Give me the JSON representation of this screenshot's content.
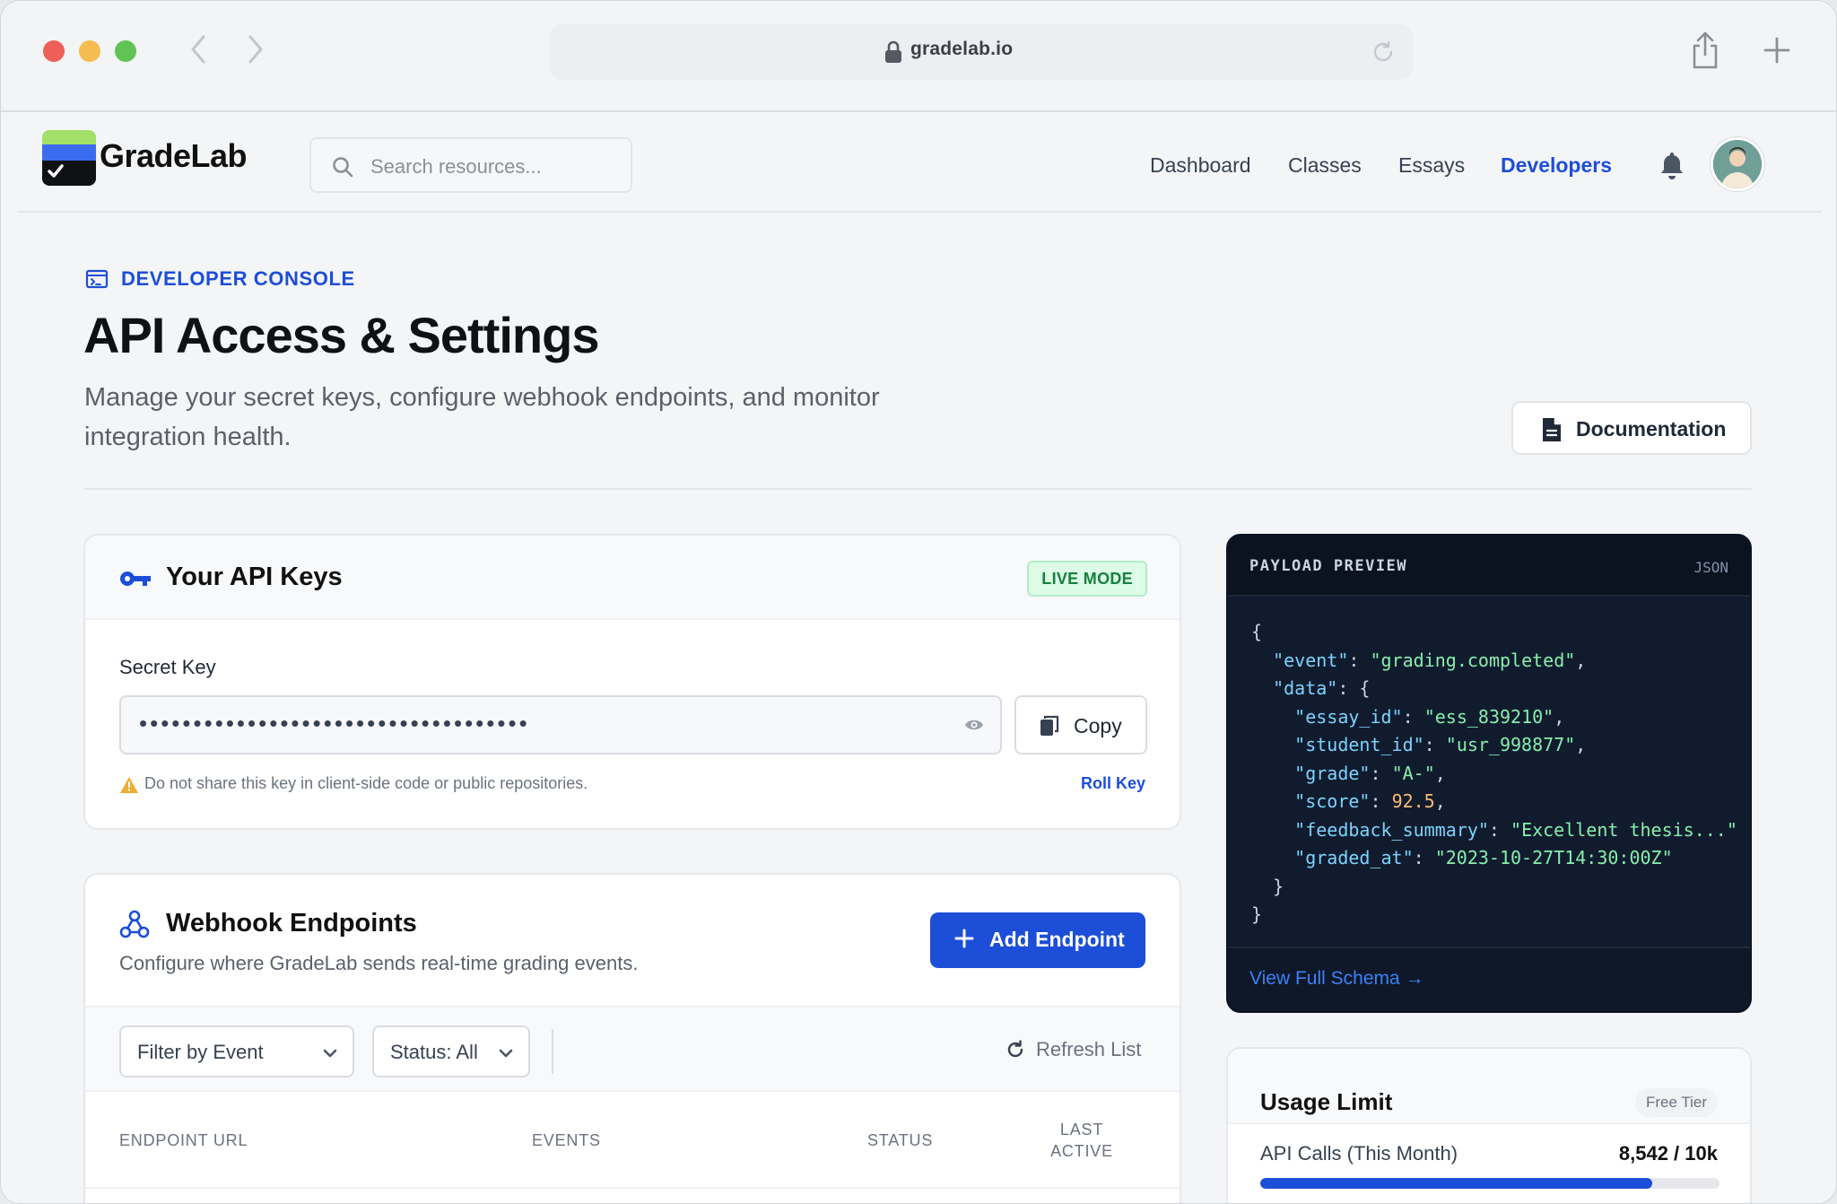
{
  "browser": {
    "url": "gradelab.io"
  },
  "header": {
    "brand": "GradeLab",
    "search_placeholder": "Search resources...",
    "nav": [
      {
        "label": "Dashboard",
        "active": false
      },
      {
        "label": "Classes",
        "active": false
      },
      {
        "label": "Essays",
        "active": false
      },
      {
        "label": "Developers",
        "active": true
      }
    ]
  },
  "page": {
    "eyebrow": "DEVELOPER CONSOLE",
    "title": "API Access & Settings",
    "subtitle": "Manage your secret keys, configure webhook endpoints, and monitor integration health.",
    "documentation_label": "Documentation"
  },
  "api_keys": {
    "title": "Your API Keys",
    "mode_badge": "LIVE MODE",
    "secret_label": "Secret Key",
    "secret_masked": "••••••••••••••••••••••••••••••••••••",
    "copy_label": "Copy",
    "warning": "Do not share this key in client-side code or public repositories.",
    "roll_key_label": "Roll Key"
  },
  "webhooks": {
    "title": "Webhook Endpoints",
    "subtitle": "Configure where GradeLab sends real-time grading events.",
    "add_label": "Add Endpoint",
    "filter_event_label": "Filter by Event",
    "filter_status_label": "Status: All",
    "refresh_label": "Refresh List",
    "columns": [
      "ENDPOINT URL",
      "EVENTS",
      "STATUS",
      "LAST ACTIVE"
    ]
  },
  "payload": {
    "title": "PAYLOAD PREVIEW",
    "format": "JSON",
    "event": "grading.completed",
    "essay_id": "ess_839210",
    "student_id": "usr_998877",
    "grade": "A-",
    "score": "92.5",
    "feedback_summary": "Excellent thesis...",
    "graded_at": "2023-10-27T14:30:00Z",
    "schema_link": "View Full Schema →"
  },
  "usage": {
    "title": "Usage Limit",
    "tier": "Free Tier",
    "metric_label": "API Calls (This Month)",
    "metric_value": "8,542 / 10k",
    "fraction": 0.8542
  },
  "colors": {
    "accent": "#1d4ed8",
    "live_green": "#15803d",
    "warning": "#f0ad2e"
  }
}
